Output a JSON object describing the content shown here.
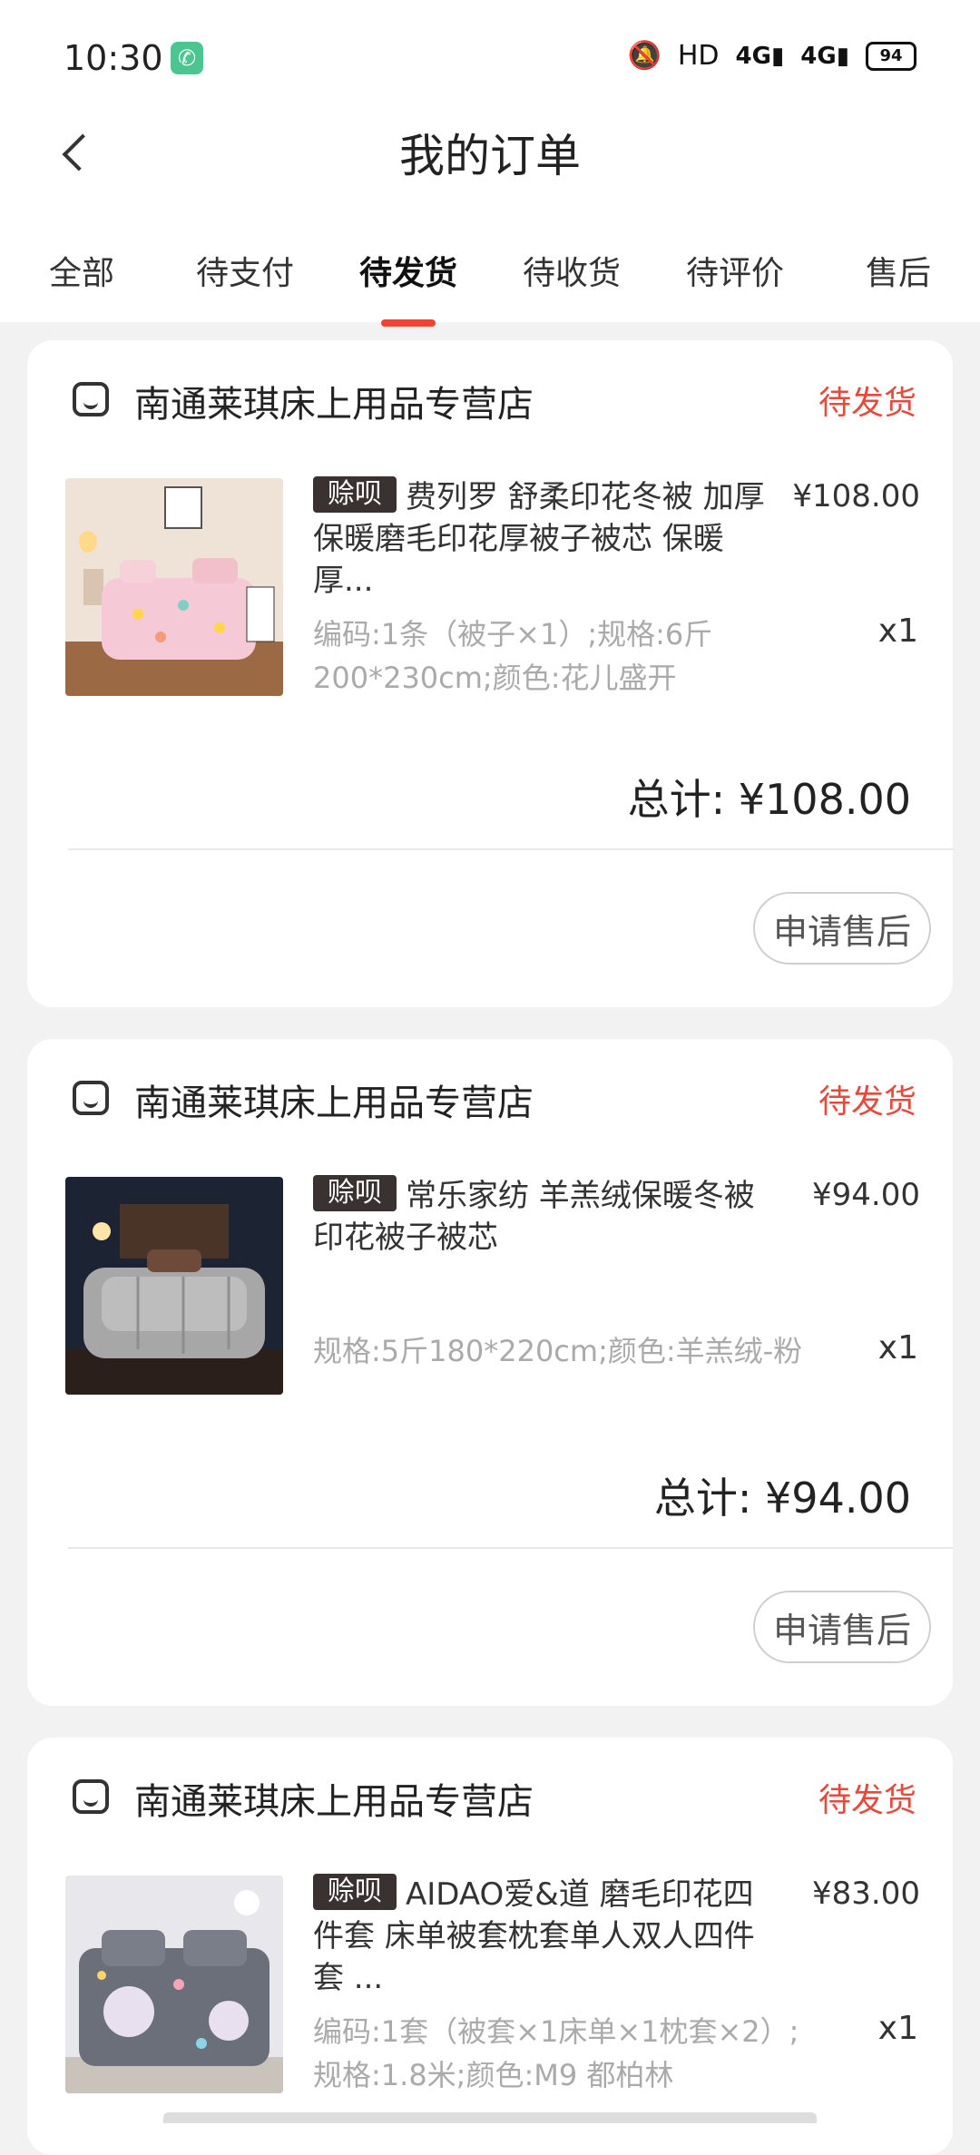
{
  "status_bar": {
    "time": "10:30",
    "hd_label": "HD",
    "signal1": "4G",
    "signal2": "4G",
    "battery": "94"
  },
  "header": {
    "title": "我的订单"
  },
  "tabs": [
    {
      "label": "全部"
    },
    {
      "label": "待支付"
    },
    {
      "label": "待发货"
    },
    {
      "label": "待收货"
    },
    {
      "label": "待评价"
    },
    {
      "label": "售后"
    }
  ],
  "active_tab": "待发货",
  "accent_color": "#e54a3c",
  "orders": [
    {
      "store": "南通莱琪床上用品专营店",
      "status": "待发货",
      "tag": "赊呗",
      "title": "费列罗 舒柔印花冬被 加厚保暖磨毛印花厚被子被芯 保暖厚...",
      "price": "¥108.00",
      "spec": "编码:1条（被子×1）;规格:6斤200*230cm;颜色:花儿盛开",
      "qty": "x1",
      "total": "总计: ¥108.00",
      "action": "申请售后"
    },
    {
      "store": "南通莱琪床上用品专营店",
      "status": "待发货",
      "tag": "赊呗",
      "title": "常乐家纺 羊羔绒保暖冬被印花被子被芯",
      "price": "¥94.00",
      "spec": "规格:5斤180*220cm;颜色:羊羔绒-粉",
      "qty": "x1",
      "total": "总计: ¥94.00",
      "action": "申请售后"
    },
    {
      "store": "南通莱琪床上用品专营店",
      "status": "待发货",
      "tag": "赊呗",
      "title": "AIDAO爱&道 磨毛印花四件套 床单被套枕套单人双人四件套 ...",
      "price": "¥83.00",
      "spec": "编码:1套（被套×1床单×1枕套×2）;规格:1.8米;颜色:M9 都柏林",
      "qty": "x1"
    }
  ]
}
